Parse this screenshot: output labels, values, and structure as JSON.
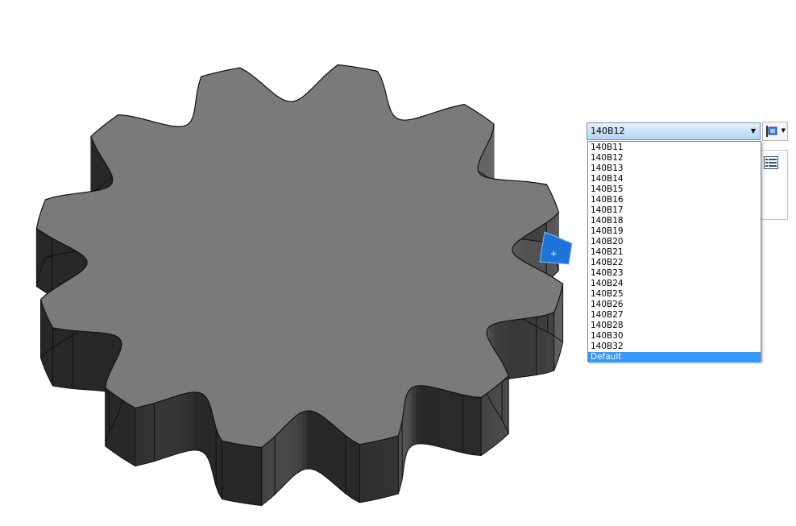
{
  "configuration": {
    "selected_value": "140B12",
    "options": [
      "140B11",
      "140B12",
      "140B13",
      "140B14",
      "140B15",
      "140B16",
      "140B17",
      "140B18",
      "140B19",
      "140B20",
      "140B21",
      "140B22",
      "140B23",
      "140B24",
      "140B25",
      "140B26",
      "140B27",
      "140B28",
      "140B30",
      "140B32",
      "Default"
    ],
    "highlighted_option": "Default"
  },
  "model": {
    "gear_teeth": 12,
    "selected_face_color": "#1e73d8",
    "top_face_color": "#7a7a7a",
    "side_color": "#3a3a3a"
  },
  "icons": {
    "combo_side_button": "configuration-flyout-icon",
    "panel_button": "list-view-icon",
    "face_marker": "plus-icon"
  }
}
